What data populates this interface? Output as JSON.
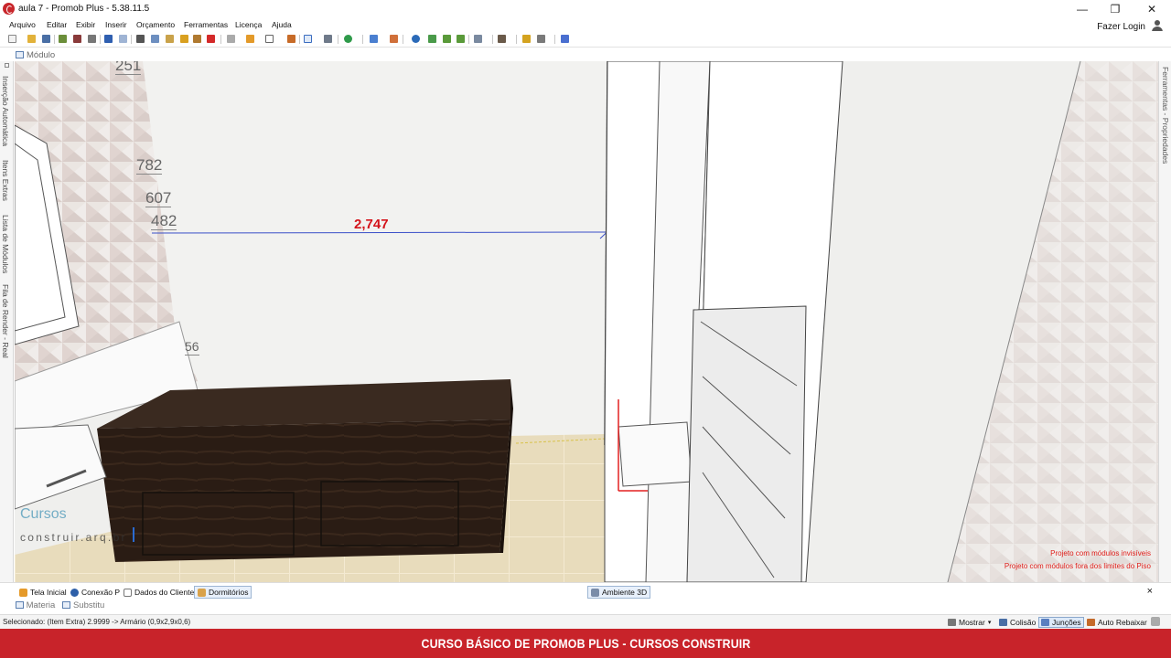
{
  "window": {
    "title": "aula 7 - Promob Plus - 5.38.11.5",
    "minimize": "—",
    "restore": "❐",
    "close": "✕"
  },
  "menu": [
    "Arquivo",
    "Editar",
    "Exibir",
    "Inserir",
    "Orçamento",
    "Ferramentas",
    "Licença",
    "Ajuda"
  ],
  "login_label": "Fazer Login",
  "viewport_tab": "Módulo",
  "left_dock_tabs": [
    "Inserção Automática",
    "Itens Extras",
    "Lista de Módulos",
    "Fila de Render - Real"
  ],
  "right_dock_tab": "Ferramentas - Propriedades",
  "scene": {
    "dimension_label": "2,747",
    "numbers": [
      "251",
      "782",
      "607",
      "482",
      "56"
    ],
    "warnings": [
      "Projeto com módulos invisíveis",
      "Projeto com módulos fora dos limites do Piso"
    ],
    "watermark": {
      "line1": "Cursos",
      "line2": "construir.arq.br"
    }
  },
  "bottom_tabs": [
    "Tela Inicial",
    "Conexão P",
    "Dados do Cliente",
    "Dormitórios",
    "Ambiente 3D"
  ],
  "bottom_close": "×",
  "lower_tabs": [
    "Materia",
    "Substitu"
  ],
  "status": {
    "selected": "Selecionado: (Item Extra) 2.9999 -> Armário (0,9x2,9x0,6)",
    "buttons": [
      "Mostrar",
      "Colisão",
      "Junções",
      "Auto Rebaixar"
    ]
  },
  "banner": "CURSO BÁSICO DE PROMOB PLUS - CURSOS CONSTRUIR",
  "colors": {
    "brand_red": "#c8232a",
    "dimension_red": "#d4141b",
    "dimension_line": "#3a4fc8"
  }
}
